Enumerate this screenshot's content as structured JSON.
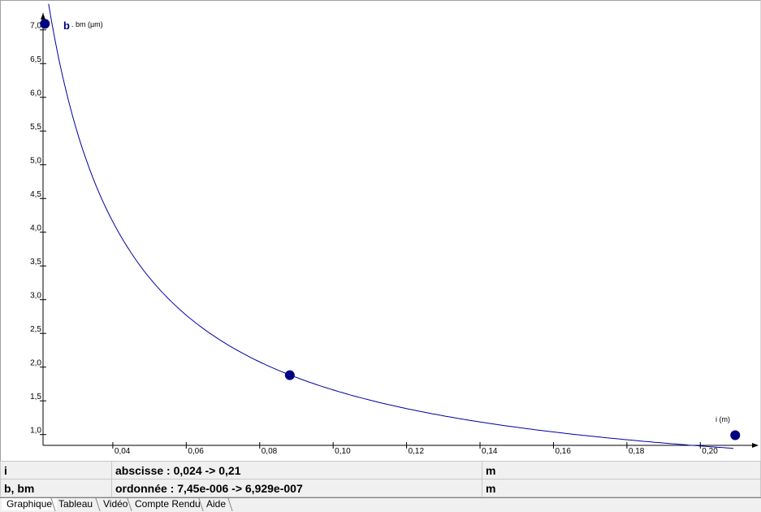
{
  "chart_data": {
    "type": "scatter",
    "ylabel_main": "b",
    "ylabel_sub": ". bm (µm)",
    "xlabel": "i (m)",
    "xlim": [
      0.021,
      0.209
    ],
    "ylim": [
      0.84,
      7.25
    ],
    "x_ticks": [
      0.04,
      0.06,
      0.08,
      0.1,
      0.12,
      0.14,
      0.16,
      0.18,
      0.2
    ],
    "x_tick_labels": [
      "0,04",
      "0,06",
      "0,08",
      "0,10",
      "0,12",
      "0,14",
      "0,16",
      "0,18",
      "0,20"
    ],
    "y_ticks": [
      1.0,
      1.5,
      2.0,
      2.5,
      3.0,
      3.5,
      4.0,
      4.5,
      5.0,
      5.5,
      6.0,
      6.5,
      7.0
    ],
    "y_tick_labels": [
      "1,0",
      "1,5",
      "2,0",
      "2,5",
      "3,0",
      "3,5",
      "4,0",
      "4,5",
      "5,0",
      "5,5",
      "6,0",
      "6,5",
      "7,0"
    ],
    "points": [
      {
        "x": 0.0215,
        "y": 7.09
      },
      {
        "x": 0.0882,
        "y": 1.88
      },
      {
        "x": 0.2095,
        "y": 0.99
      }
    ],
    "fit_curve": {
      "type": "reciprocal",
      "k": 0.1662,
      "x_range": [
        0.0225,
        0.209
      ]
    },
    "grid": false,
    "colors": {
      "curve": "#0000a0",
      "points": "#000080",
      "axis": "#000000"
    }
  },
  "info_rows": [
    {
      "name": "i",
      "range": "abscisse : 0,024 -> 0,21",
      "unit": "m"
    },
    {
      "name": "b, bm",
      "range": "ordonnée : 7,45e-006 -> 6,929e-007",
      "unit": "m"
    }
  ],
  "tabs": [
    {
      "label": "Graphique",
      "active": true
    },
    {
      "label": "Tableau",
      "active": false
    },
    {
      "label": "Vidéo",
      "active": false
    },
    {
      "label": "Compte Rendu",
      "active": false
    },
    {
      "label": "Aide",
      "active": false
    }
  ]
}
